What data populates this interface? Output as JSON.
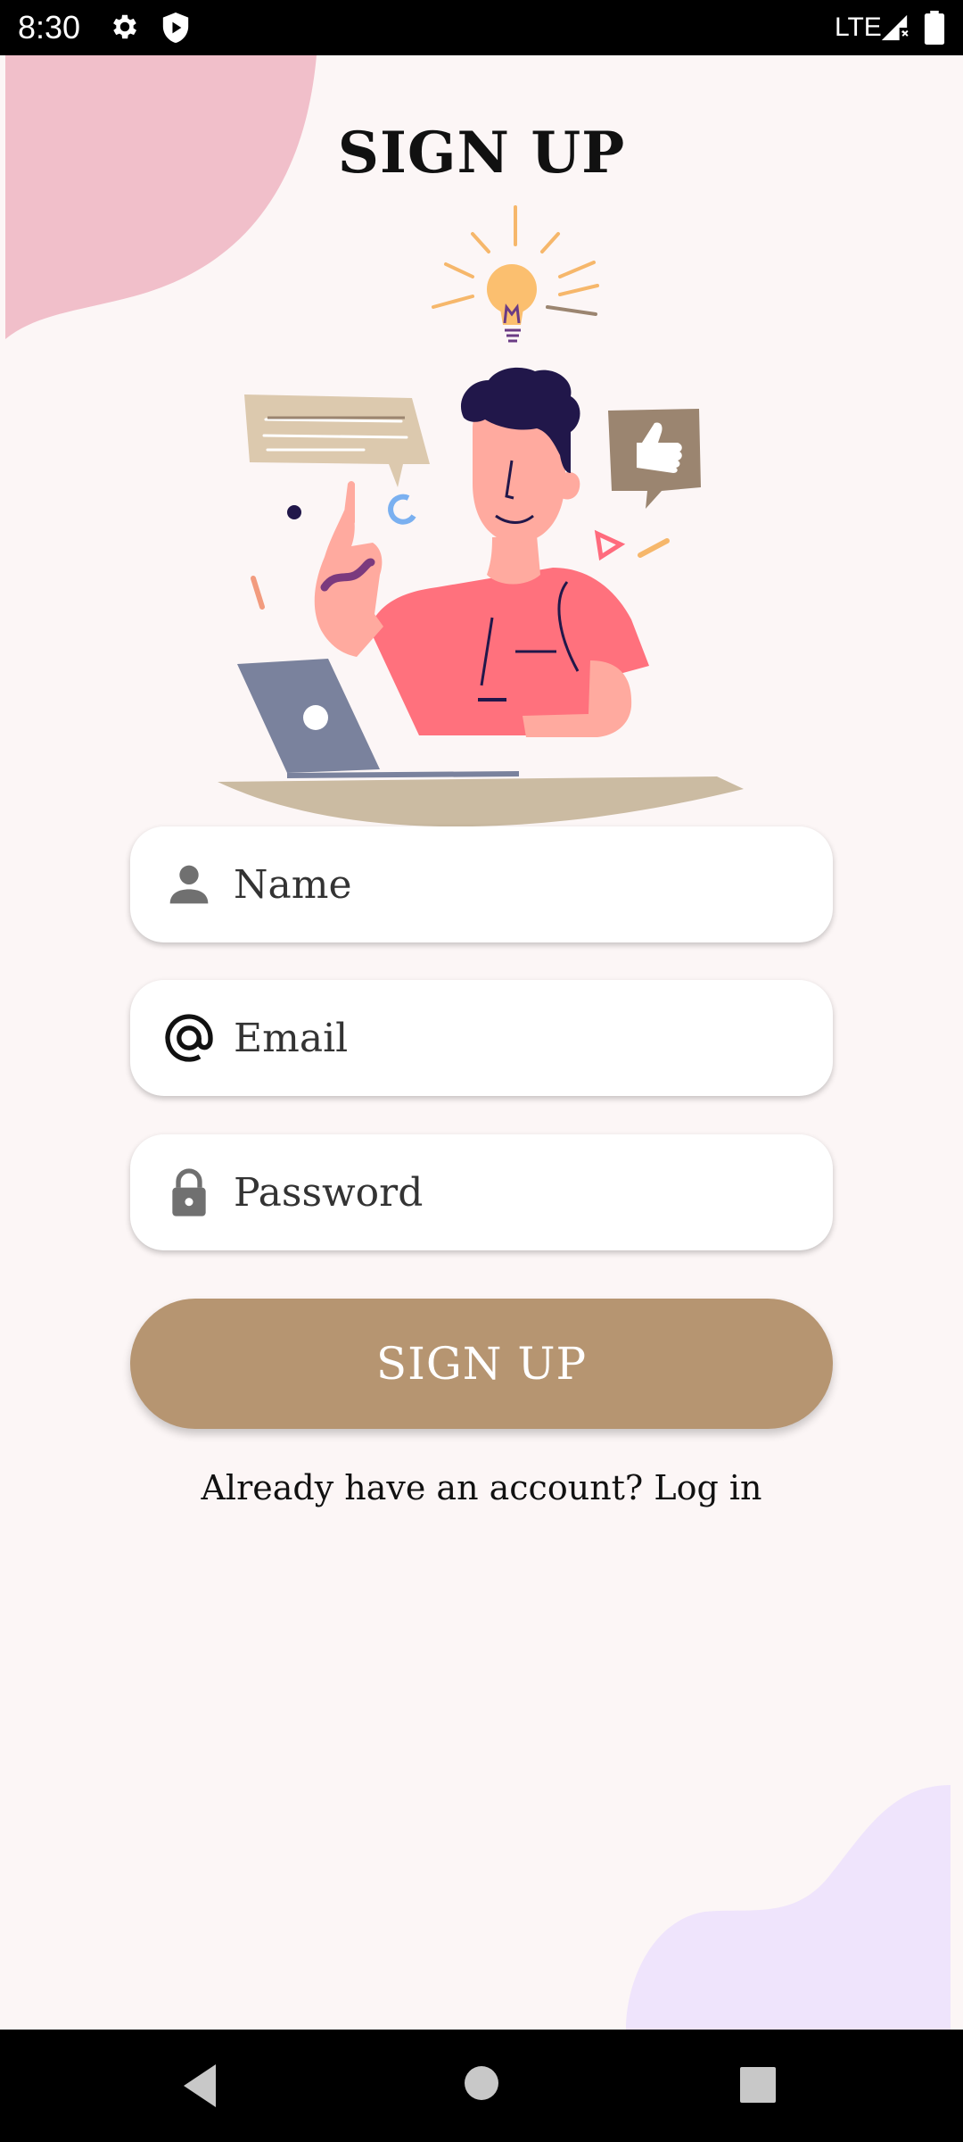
{
  "status_bar": {
    "time": "8:30",
    "network": "LTE",
    "icons": [
      "settings-icon",
      "shield-icon",
      "signal-icon",
      "battery-icon"
    ]
  },
  "screen": {
    "title": "SIGN UP",
    "fields": {
      "name": {
        "placeholder": "Name",
        "value": "",
        "icon": "person-icon"
      },
      "email": {
        "placeholder": "Email",
        "value": "",
        "icon": "at-icon"
      },
      "password": {
        "placeholder": "Password",
        "value": "",
        "icon": "lock-icon"
      }
    },
    "signup_button": "SIGN UP",
    "login_prompt": "Already have an account? Log in"
  },
  "nav_bar": {
    "icons": [
      "back-icon",
      "home-icon",
      "recents-icon"
    ]
  },
  "colors": {
    "background": "#fcf6f6",
    "accent": "#b69571",
    "top_blob": "#f1bfca",
    "bottom_blob": "#efe4fc",
    "shirt": "#ff717d"
  }
}
